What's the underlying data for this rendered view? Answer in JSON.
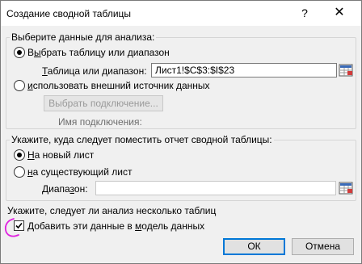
{
  "window": {
    "title": "Создание сводной таблицы",
    "help_glyph": "?",
    "close_glyph": "✕"
  },
  "section_data": {
    "label": "Выберите данные для анализа:",
    "option_table": {
      "label_pre": "В",
      "label_ul": "ы",
      "label_post": "брать таблицу или диапазон",
      "selected": true
    },
    "range_label_ul": "Т",
    "range_label_post": "аблица или диапазон:",
    "range_value": "Лист1!$C$3:$I$23",
    "option_external": {
      "label_ul": "и",
      "label_post": "спользовать внешний источник данных",
      "selected": false
    },
    "choose_connection": "Выбрать подключение...",
    "connection_name_label": "Имя подключения:"
  },
  "section_place": {
    "label": "Укажите, куда следует поместить отчет сводной таблицы:",
    "option_new": {
      "label_pre": "",
      "label_ul": "Н",
      "label_post": "а новый лист",
      "selected": true
    },
    "option_existing": {
      "label_ul": "н",
      "label_post": "а существующий лист",
      "selected": false
    },
    "range_label_pre": "Диапа",
    "range_label_ul": "з",
    "range_label_post": "он:",
    "range_value": ""
  },
  "section_multi": {
    "label": "Укажите, следует ли анализ несколько таблиц",
    "checkbox_pre": "Добавить эти данные в ",
    "checkbox_ul": "м",
    "checkbox_post": "одель данных",
    "checked": true
  },
  "buttons": {
    "ok": "ОК",
    "cancel": "Отмена"
  },
  "colors": {
    "annotation": "#e020e0",
    "accent": "#0078d7"
  }
}
